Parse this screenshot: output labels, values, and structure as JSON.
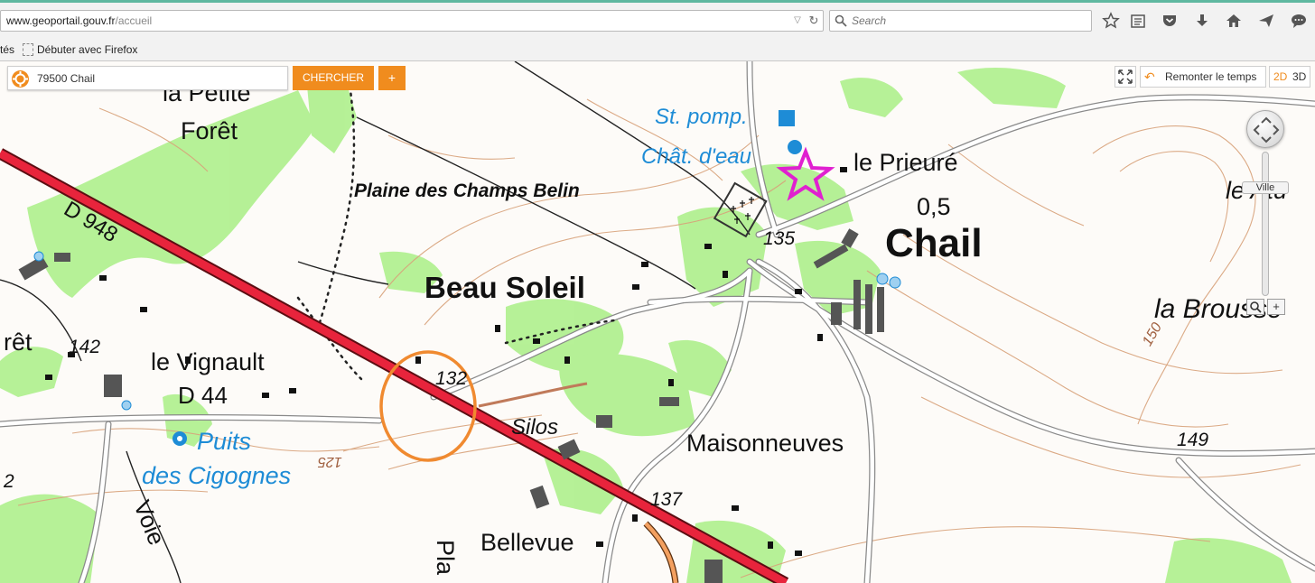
{
  "browser": {
    "url_host": "www.geoportail.gouv.fr",
    "url_path": "/accueil",
    "search_placeholder": "Search",
    "bookmarks": {
      "most_visited_fragment": "tés",
      "getting_started": "Débuter avec Firefox"
    },
    "toolbar_icons": [
      "star-icon",
      "reading-list-icon",
      "pocket-icon",
      "download-icon",
      "home-icon",
      "send-icon",
      "chat-icon"
    ]
  },
  "map_ui": {
    "place_value": "79500 Chail",
    "search_label": "CHERCHER",
    "plus_label": "+",
    "timeback_label": "Remonter le temps",
    "view_2d": "2D",
    "view_3d": "3D",
    "zoom_level_label": "Ville",
    "zoom_in": "+",
    "accent_color": "#f08c1e"
  },
  "map_labels": {
    "la_petite": "la Petite",
    "foret_top": "Forêt",
    "d948": "D 948",
    "plaine": "Plaine des Champs Belin",
    "st_pomp": "St. pomp.",
    "chat_deau": "Chât. d'eau",
    "le_prieure": "le Prieuré",
    "val_05": "0,5",
    "chail": "Chail",
    "le_atu": "le Atu",
    "elev_135": "135",
    "beau_soleil": "Beau Soleil",
    "la_brousse": "la Brousse",
    "foret_left": "rêt",
    "elev_142": "142",
    "le_vignault": "le Vignault",
    "d44": "D 44",
    "elev_132": "132",
    "elev_150": "150",
    "silos": "Silos",
    "maisonneuves": "Maisonneuves",
    "puits": "Puits",
    "des_cigognes": "des Cigognes",
    "elev_125": "125",
    "elev_149": "149",
    "elev_137": "137",
    "voie": "Voie",
    "bellevue": "Bellevue",
    "pla": "Pla",
    "left_2": "2"
  }
}
